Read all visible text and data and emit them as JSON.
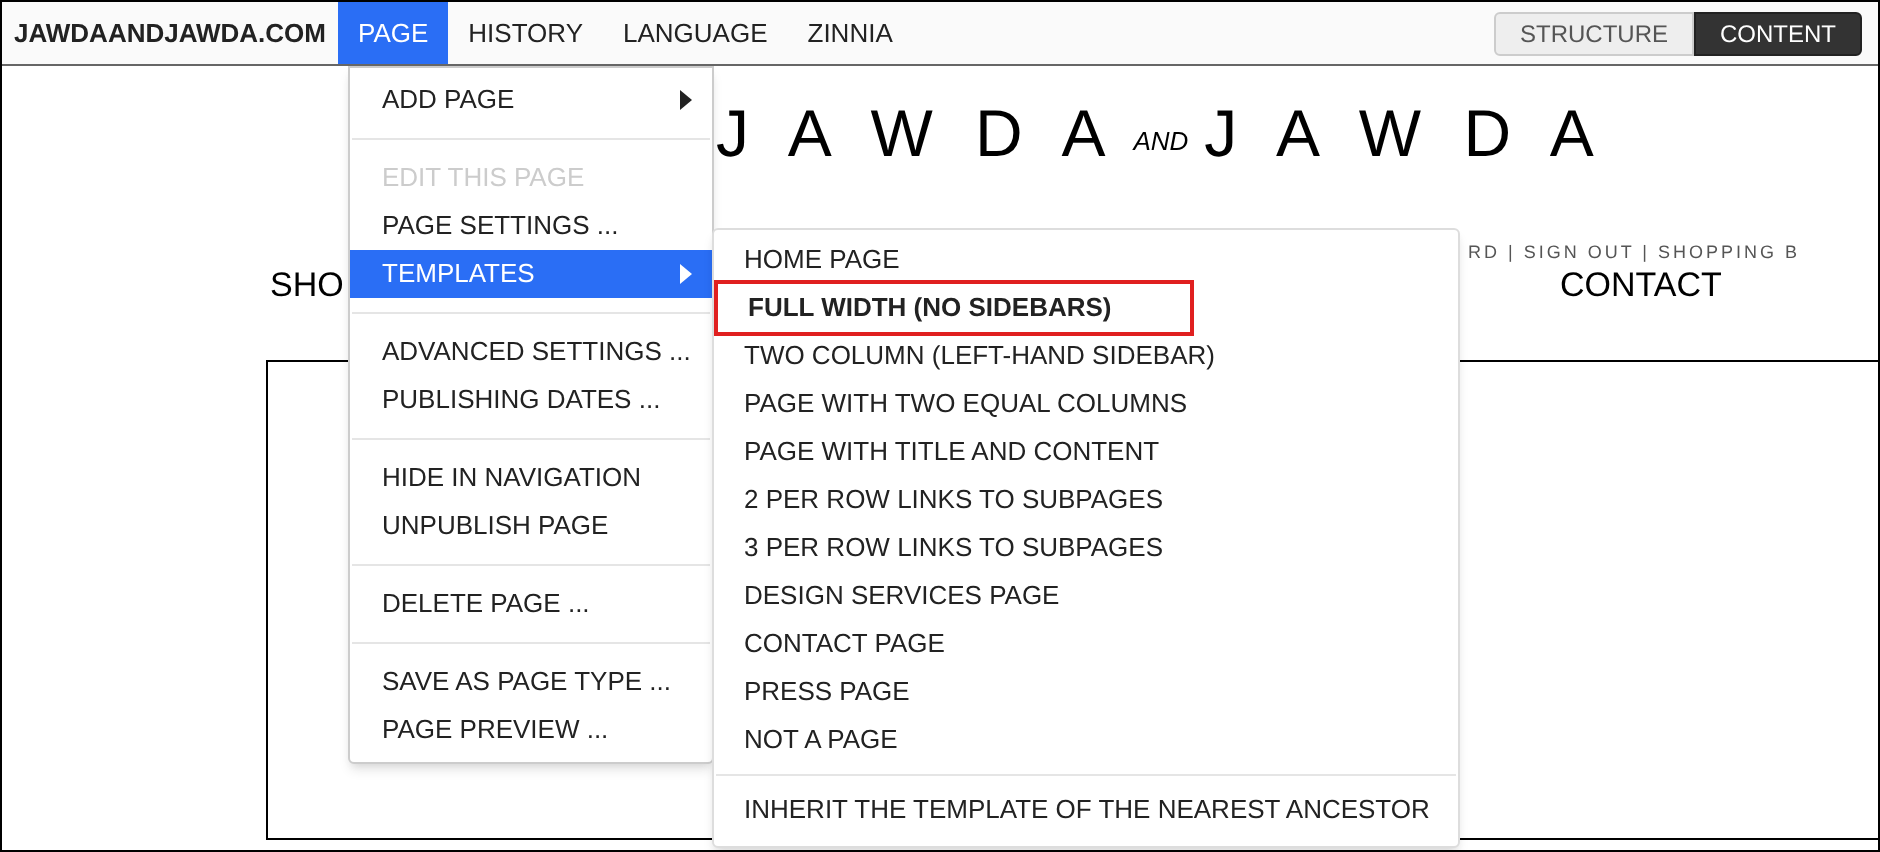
{
  "toolbar": {
    "site": "JAWDAANDJAWDA.COM",
    "menus": [
      {
        "label": "PAGE",
        "selected": true
      },
      {
        "label": "HISTORY",
        "selected": false
      },
      {
        "label": "LANGUAGE",
        "selected": false
      },
      {
        "label": "ZINNIA",
        "selected": false
      }
    ],
    "modes": [
      {
        "label": "STRUCTURE",
        "selected": false
      },
      {
        "label": "CONTENT",
        "selected": true
      }
    ]
  },
  "site": {
    "logo_left": "J A W D A",
    "logo_and": "AND",
    "logo_right": "J A W D A",
    "account_links": "RD | SIGN OUT | SHOPPING B",
    "nav": [
      "SHO",
      "CONTACT"
    ]
  },
  "page_menu": [
    [
      {
        "label": "ADD PAGE",
        "disabled": false,
        "submenu": true,
        "selected": false
      }
    ],
    [
      {
        "label": "EDIT THIS PAGE",
        "disabled": true,
        "submenu": false,
        "selected": false
      },
      {
        "label": "PAGE SETTINGS ...",
        "disabled": false,
        "submenu": false,
        "selected": false
      },
      {
        "label": "TEMPLATES",
        "disabled": false,
        "submenu": true,
        "selected": true
      }
    ],
    [
      {
        "label": "ADVANCED SETTINGS ...",
        "disabled": false,
        "submenu": false,
        "selected": false
      },
      {
        "label": "PUBLISHING DATES ...",
        "disabled": false,
        "submenu": false,
        "selected": false
      }
    ],
    [
      {
        "label": "HIDE IN NAVIGATION",
        "disabled": false,
        "submenu": false,
        "selected": false
      },
      {
        "label": "UNPUBLISH PAGE",
        "disabled": false,
        "submenu": false,
        "selected": false
      }
    ],
    [
      {
        "label": "DELETE PAGE ...",
        "disabled": false,
        "submenu": false,
        "selected": false
      }
    ],
    [
      {
        "label": "SAVE AS PAGE TYPE ...",
        "disabled": false,
        "submenu": false,
        "selected": false
      },
      {
        "label": "PAGE PREVIEW ...",
        "disabled": false,
        "submenu": false,
        "selected": false
      }
    ]
  ],
  "templates_menu": [
    [
      {
        "label": "HOME PAGE",
        "selected": false
      },
      {
        "label": "FULL WIDTH (NO SIDEBARS)",
        "selected": true
      },
      {
        "label": "TWO COLUMN (LEFT-HAND SIDEBAR)",
        "selected": false
      },
      {
        "label": "PAGE WITH TWO EQUAL COLUMNS",
        "selected": false
      },
      {
        "label": "PAGE WITH TITLE AND CONTENT",
        "selected": false
      },
      {
        "label": "2 PER ROW LINKS TO SUBPAGES",
        "selected": false
      },
      {
        "label": "3 PER ROW LINKS TO SUBPAGES",
        "selected": false
      },
      {
        "label": "DESIGN SERVICES PAGE",
        "selected": false
      },
      {
        "label": "CONTACT PAGE",
        "selected": false
      },
      {
        "label": "PRESS PAGE",
        "selected": false
      },
      {
        "label": "NOT A PAGE",
        "selected": false
      }
    ],
    [
      {
        "label": "INHERIT THE TEMPLATE OF THE NEAREST ANCESTOR",
        "selected": false
      }
    ]
  ]
}
